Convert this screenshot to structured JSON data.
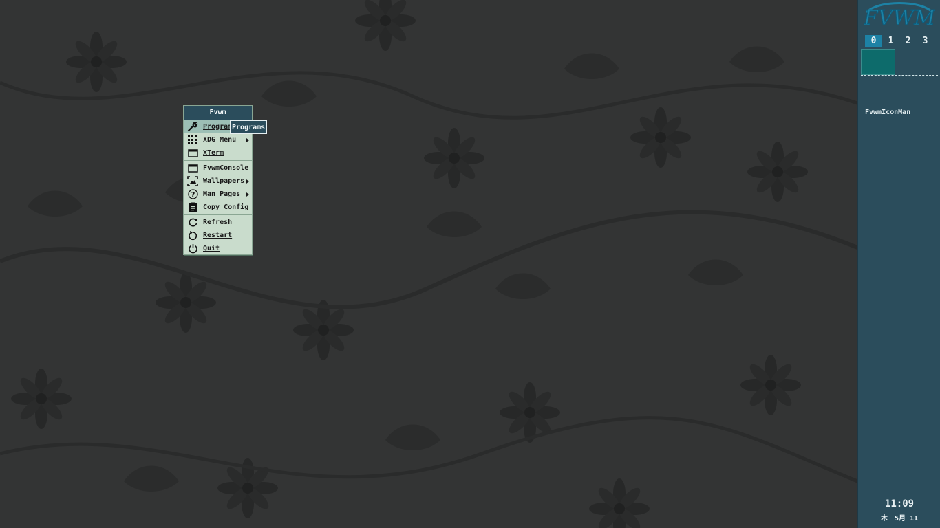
{
  "wallpaper": {
    "base_color": "#333434",
    "pattern_color": "#262727",
    "pattern": "floral-damask"
  },
  "panel": {
    "logo_text": "FVWM",
    "desks": [
      "0",
      "1",
      "2",
      "3"
    ],
    "active_desk": "0",
    "iconman_label": "FvwmIconMan",
    "clock": {
      "time": "11:09",
      "date": "木　5月 11"
    }
  },
  "menu": {
    "title": "Fvwm",
    "items": [
      {
        "label": "Programs",
        "icon": "wrench-icon",
        "submenu": false,
        "hover": true
      },
      {
        "label": "XDG Menu",
        "icon": "grid-icon",
        "submenu": true
      },
      {
        "label": "XTerm",
        "icon": "terminal-window-icon",
        "submenu": false
      },
      {
        "label": "FvwmConsole",
        "icon": "console-window-icon",
        "submenu": false
      },
      {
        "label": "Wallpapers",
        "icon": "wallpaper-icon",
        "submenu": true
      },
      {
        "label": "Man Pages",
        "icon": "help-icon",
        "submenu": true
      },
      {
        "label": "Copy Config",
        "icon": "clipboard-icon",
        "submenu": false
      },
      {
        "label": "Refresh",
        "icon": "refresh-icon",
        "submenu": false
      },
      {
        "label": "Restart",
        "icon": "restart-icon",
        "submenu": false
      },
      {
        "label": "Quit",
        "icon": "power-icon",
        "submenu": false
      }
    ],
    "tooltip": "Programs"
  }
}
